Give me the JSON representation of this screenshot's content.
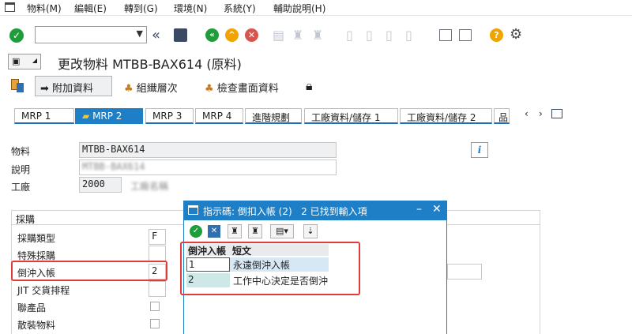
{
  "menubar": {
    "items": [
      "物料(M)",
      "編輯(E)",
      "轉到(G)",
      "環境(N)",
      "系統(Y)",
      "輔助說明(H)"
    ]
  },
  "toolbar": {
    "command_field_value": ""
  },
  "page": {
    "title": "更改物料 MTBB-BAX614 (原料)"
  },
  "app_toolbar": {
    "additional_data": "附加資料",
    "org_levels": "組織層次",
    "check_screen_data": "檢查畫面資料"
  },
  "tabs": [
    {
      "label": "MRP 1"
    },
    {
      "label": "MRP 2"
    },
    {
      "label": "MRP 3"
    },
    {
      "label": "MRP 4"
    },
    {
      "label": "進階規劃"
    },
    {
      "label": "工廠資料/儲存 1"
    },
    {
      "label": "工廠資料/儲存 2"
    },
    {
      "label": "品"
    }
  ],
  "form": {
    "material_label": "物料",
    "material_value": "MTBB-BAX614",
    "description_label": "說明",
    "description_value": "MTBB-BAX614",
    "plant_label": "工廠",
    "plant_value": "2000",
    "plant_desc": "工廠名稱"
  },
  "procurement": {
    "group_title": "採購",
    "procurement_type_label": "採購類型",
    "procurement_type_value": "F",
    "special_procurement_label": "特殊採購",
    "special_procurement_value": "",
    "backflush_label": "倒沖入帳",
    "backflush_value": "2",
    "jit_label": "JIT 交貨排程",
    "coproduct_label": "聯產品",
    "bulk_material_label": "散裝物料"
  },
  "dialog": {
    "title": "指示碼: 倒扣入帳 (2)   2 已找到輸入項",
    "columns": [
      "倒沖入帳",
      "短文"
    ],
    "rows": [
      {
        "code": "1",
        "text": "永遠倒沖入帳"
      },
      {
        "code": "2",
        "text": "工作中心決定是否倒沖"
      }
    ]
  },
  "colors": {
    "sap_blue": "#1f7fc6",
    "highlight_red": "#e23b3b",
    "ok_green": "#1f9d3a"
  }
}
